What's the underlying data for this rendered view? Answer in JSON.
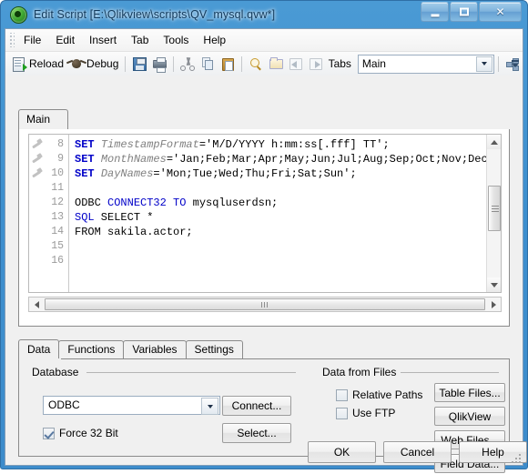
{
  "window": {
    "title": "Edit Script [E:\\Qlikview\\scripts\\QV_mysql.qvw*]",
    "icon": "qlikview-logo-icon",
    "buttons": {
      "minimize": "minimize-icon",
      "maximize": "maximize-icon",
      "close": "✕"
    }
  },
  "menubar": {
    "items": [
      {
        "label": "File"
      },
      {
        "label": "Edit"
      },
      {
        "label": "Insert"
      },
      {
        "label": "Tab"
      },
      {
        "label": "Tools"
      },
      {
        "label": "Help"
      }
    ]
  },
  "toolbar": {
    "reload_label": "Reload",
    "debug_label": "Debug",
    "tabs_label": "Tabs",
    "tabs_value": "Main",
    "icons": {
      "reload": "reload-script-icon",
      "debug": "debug-bug-icon",
      "save": "save-floppy-icon",
      "print": "print-icon",
      "cut": "cut-scissors-icon",
      "copy": "copy-icon",
      "paste": "paste-icon",
      "search": "search-magnifier-icon",
      "new_tab": "new-tab-folder-icon",
      "prev_tab": "previous-tab-icon",
      "next_tab": "next-tab-icon",
      "diagram": "table-viewer-icon",
      "overflow": "toolbar-overflow-icon"
    }
  },
  "script": {
    "tabs": [
      {
        "label": "Main",
        "active": true
      }
    ],
    "lines": [
      {
        "num": "8",
        "mark": true,
        "segments": [
          {
            "t": "SET ",
            "c": "kw"
          },
          {
            "t": "TimestampFormat",
            "c": "var"
          },
          {
            "t": "='M/D/YYYY h:mm:ss[.fff] TT';",
            "c": ""
          }
        ]
      },
      {
        "num": "9",
        "mark": true,
        "segments": [
          {
            "t": "SET ",
            "c": "kw"
          },
          {
            "t": "MonthNames",
            "c": "var"
          },
          {
            "t": "='Jan;Feb;Mar;Apr;May;Jun;Jul;Aug;Sep;Oct;Nov;Dec';",
            "c": ""
          }
        ]
      },
      {
        "num": "10",
        "mark": true,
        "segments": [
          {
            "t": "SET ",
            "c": "kw"
          },
          {
            "t": "DayNames",
            "c": "var"
          },
          {
            "t": "='Mon;Tue;Wed;Thu;Fri;Sat;Sun';",
            "c": ""
          }
        ]
      },
      {
        "num": "11",
        "mark": false,
        "segments": [
          {
            "t": "",
            "c": ""
          }
        ]
      },
      {
        "num": "12",
        "mark": false,
        "segments": [
          {
            "t": "ODBC ",
            "c": ""
          },
          {
            "t": "CONNECT32 TO",
            "c": "kw-n"
          },
          {
            "t": " mysqluserdsn;",
            "c": ""
          }
        ]
      },
      {
        "num": "13",
        "mark": false,
        "segments": [
          {
            "t": "SQL",
            "c": "kw-n"
          },
          {
            "t": " SELECT *",
            "c": ""
          }
        ]
      },
      {
        "num": "14",
        "mark": false,
        "segments": [
          {
            "t": "FROM sakila.actor;",
            "c": ""
          }
        ]
      },
      {
        "num": "15",
        "mark": false,
        "segments": [
          {
            "t": "",
            "c": ""
          }
        ]
      },
      {
        "num": "16",
        "mark": false,
        "segments": [
          {
            "t": "",
            "c": ""
          }
        ]
      }
    ]
  },
  "lower_tabs": [
    {
      "label": "Data",
      "active": true
    },
    {
      "label": "Functions",
      "active": false
    },
    {
      "label": "Variables",
      "active": false
    },
    {
      "label": "Settings",
      "active": false
    }
  ],
  "data_tab": {
    "database": {
      "group_label": "Database",
      "combo_value": "ODBC",
      "force32_label": "Force 32 Bit",
      "force32_checked": true,
      "connect_label": "Connect...",
      "select_label": "Select..."
    },
    "files": {
      "group_label": "Data from Files",
      "relative_paths_label": "Relative Paths",
      "relative_paths_checked": false,
      "use_ftp_label": "Use FTP",
      "use_ftp_checked": false,
      "table_files_label": "Table Files...",
      "qlikview_file_label": "QlikView File...",
      "web_files_label": "Web Files...",
      "field_data_label": "Field Data..."
    }
  },
  "dialog_buttons": {
    "ok": "OK",
    "cancel": "Cancel",
    "help": "Help"
  },
  "colors": {
    "titlebar_blue": "#3e8fce",
    "keyword_blue": "#0000c8",
    "variable_gray": "#808080",
    "panel_gray": "#f0f0f0"
  }
}
